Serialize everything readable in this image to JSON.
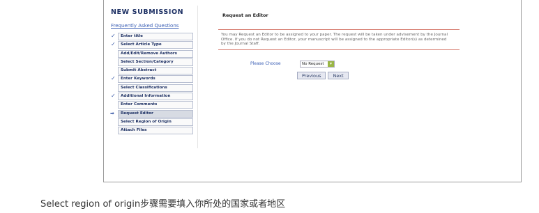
{
  "submission": {
    "title": "NEW SUBMISSION",
    "faq_link": "Frequently Asked Questions"
  },
  "steps": [
    {
      "label": "Enter title",
      "state": "done"
    },
    {
      "label": "Select Article Type",
      "state": "done"
    },
    {
      "label": "Add/Edit/Remove Authors",
      "state": "todo"
    },
    {
      "label": "Select Section/Category",
      "state": "todo"
    },
    {
      "label": "Submit Abstract",
      "state": "todo"
    },
    {
      "label": "Enter Keywords",
      "state": "done"
    },
    {
      "label": "Select Classifications",
      "state": "todo"
    },
    {
      "label": "Additional Information",
      "state": "done"
    },
    {
      "label": "Enter Comments",
      "state": "todo"
    },
    {
      "label": "Request Editor",
      "state": "current"
    },
    {
      "label": "Select Region of Origin",
      "state": "todo"
    },
    {
      "label": "Attach Files",
      "state": "todo"
    }
  ],
  "main": {
    "section_title": "Request an Editor",
    "message": "You may Request an Editor to be assigned to your paper. The request will be taken under advisement by the Journal Office. If you do not Request an Editor, your manuscript will be assigned to the appropriate Editor(s) as determined by the Journal Staff.",
    "choose_label": "Please Choose",
    "select_value": "No Request",
    "previous_label": "Previous",
    "next_label": "Next"
  },
  "caption": "Select region of origin步骤需要填入你所处的国家或者地区",
  "colors": {
    "accent_rule": "#d67a6e",
    "nav_text": "#1c2f63",
    "link": "#3b5fb5",
    "check": "#3c5ca8",
    "dropdown": "#9ab645"
  },
  "icons": {
    "done": "check-icon",
    "current": "arrow-right-icon",
    "dropdown": "chevron-down-icon"
  }
}
